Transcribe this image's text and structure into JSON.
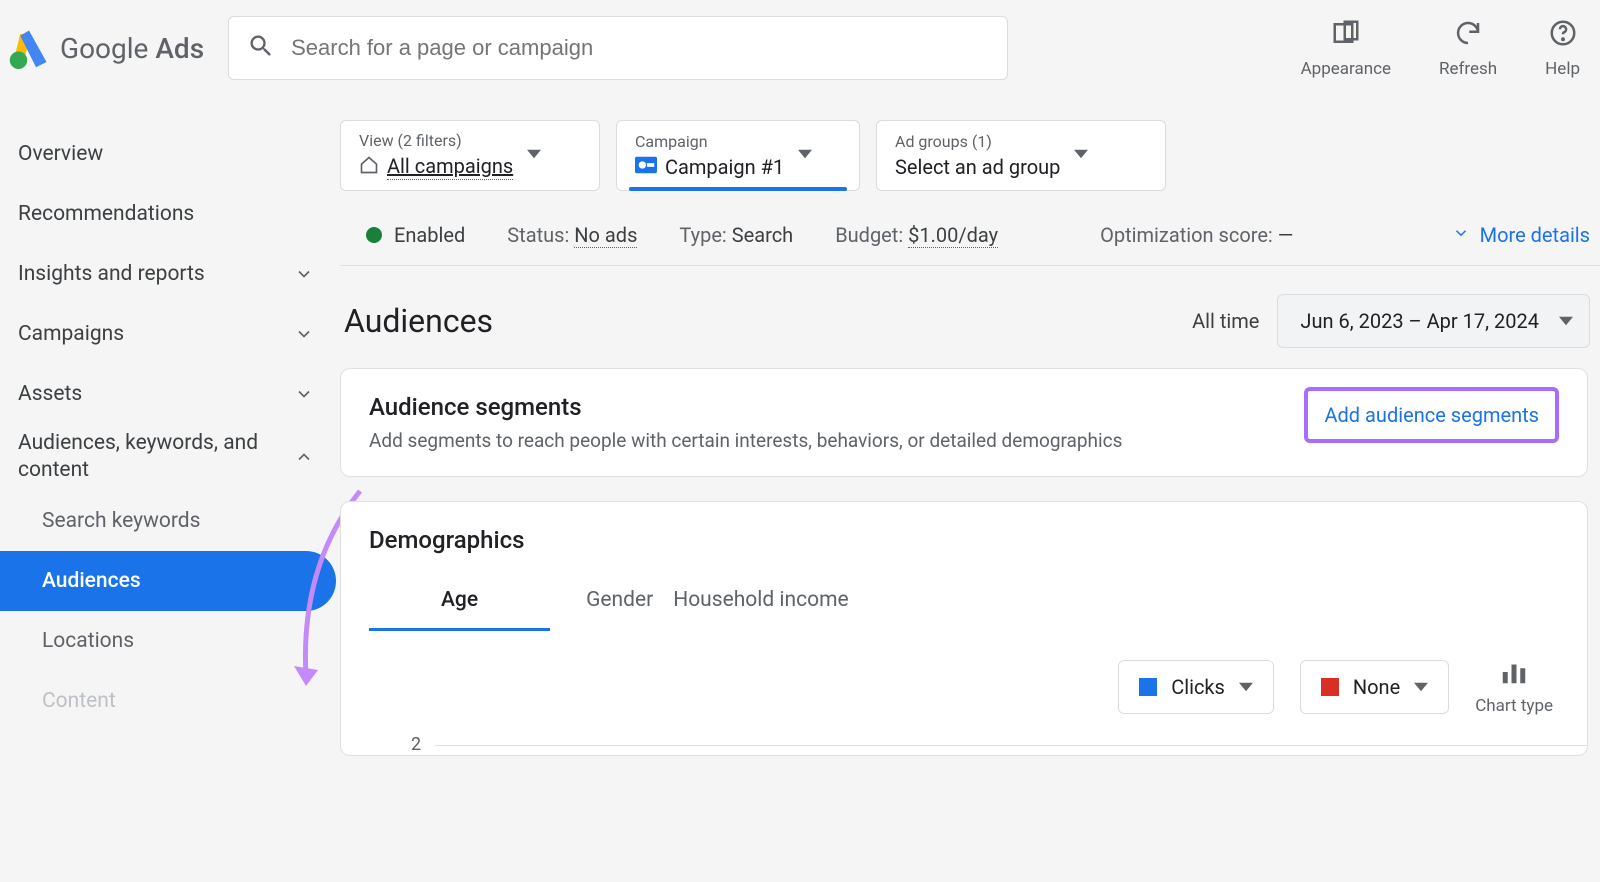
{
  "header": {
    "logo_text_main": "Google ",
    "logo_text_sub": "Ads",
    "search_placeholder": "Search for a page or campaign",
    "actions": {
      "appearance": "Appearance",
      "refresh": "Refresh",
      "help": "Help"
    }
  },
  "sidebar": {
    "overview": "Overview",
    "recommendations": "Recommendations",
    "insights": "Insights and reports",
    "campaigns": "Campaigns",
    "assets": "Assets",
    "akc": "Audiences, keywords, and content",
    "search_keywords": "Search keywords",
    "audiences": "Audiences",
    "locations": "Locations",
    "content": "Content"
  },
  "chips": {
    "view_top": "View (2 filters)",
    "view_value": "All campaigns",
    "campaign_top": "Campaign",
    "campaign_value": "Campaign #1",
    "adgroup_top": "Ad groups (1)",
    "adgroup_value": "Select an ad group"
  },
  "statusrow": {
    "enabled": "Enabled",
    "status_label": "Status: ",
    "status_value": "No ads",
    "type_label": "Type: ",
    "type_value": "Search",
    "budget_label": "Budget: ",
    "budget_value": "$1.00/day",
    "optscore_label": "Optimization score: ",
    "optscore_value": "—",
    "more_details": "More details"
  },
  "title": "Audiences",
  "alltime": "All time",
  "daterange": "Jun 6, 2023 – Apr 17, 2024",
  "segments_card": {
    "title": "Audience segments",
    "subtitle": "Add segments to reach people with certain interests, behaviors, or detailed demographics",
    "action": "Add audience segments"
  },
  "demo_card": {
    "title": "Demographics",
    "tabs": {
      "age": "Age",
      "gender": "Gender",
      "income": "Household income"
    },
    "sel1": "Clicks",
    "sel2": "None",
    "chart_type": "Chart type",
    "axis_label": "2"
  },
  "chart_data": {
    "type": "bar",
    "title": "Demographics — Age",
    "ylabel": "Clicks",
    "ylim": [
      0,
      2
    ],
    "categories": [],
    "values": []
  }
}
